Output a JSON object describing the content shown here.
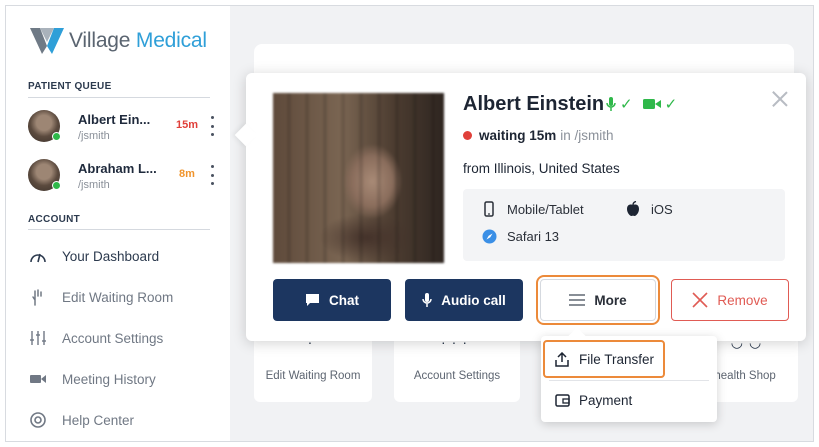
{
  "brand": {
    "name_part1": "Village",
    "name_part2": "Medical"
  },
  "sidebar": {
    "queue_label": "PATIENT QUEUE",
    "queue": [
      {
        "name": "Albert Ein...",
        "user": "/jsmith",
        "wait": "15m",
        "wait_color": "#e0403a"
      },
      {
        "name": "Abraham L...",
        "user": "/jsmith",
        "wait": "8m",
        "wait_color": "#f0942c"
      }
    ],
    "account_label": "ACCOUNT",
    "nav": [
      {
        "label": "Your Dashboard",
        "icon": "gauge-icon"
      },
      {
        "label": "Edit Waiting Room",
        "icon": "hand-icon"
      },
      {
        "label": "Account Settings",
        "icon": "sliders-icon"
      },
      {
        "label": "Meeting History",
        "icon": "video-camera-icon"
      },
      {
        "label": "Help Center",
        "icon": "lifebuoy-icon"
      }
    ]
  },
  "tiles": [
    {
      "label": "Edit Waiting Room"
    },
    {
      "label": "Account Settings"
    },
    {
      "label": "ehealth Shop"
    }
  ],
  "patient": {
    "name": "Albert Einstein",
    "status_text": "waiting 15m",
    "status_in": "in /jsmith",
    "location": "from Illinois, United States",
    "device": "Mobile/Tablet",
    "os": "iOS",
    "browser": "Safari 13",
    "check": "✓"
  },
  "actions": {
    "chat": "Chat",
    "audio_call": "Audio call",
    "more": "More",
    "remove": "Remove"
  },
  "more_menu": {
    "items": [
      {
        "label": "File Transfer"
      },
      {
        "label": "Payment"
      }
    ]
  },
  "colors": {
    "navy": "#1c3660",
    "accent_blue": "#2f9fd8",
    "highlight": "#ec8a3a",
    "remove_red": "#e05b54",
    "online_green": "#2fb84a"
  }
}
